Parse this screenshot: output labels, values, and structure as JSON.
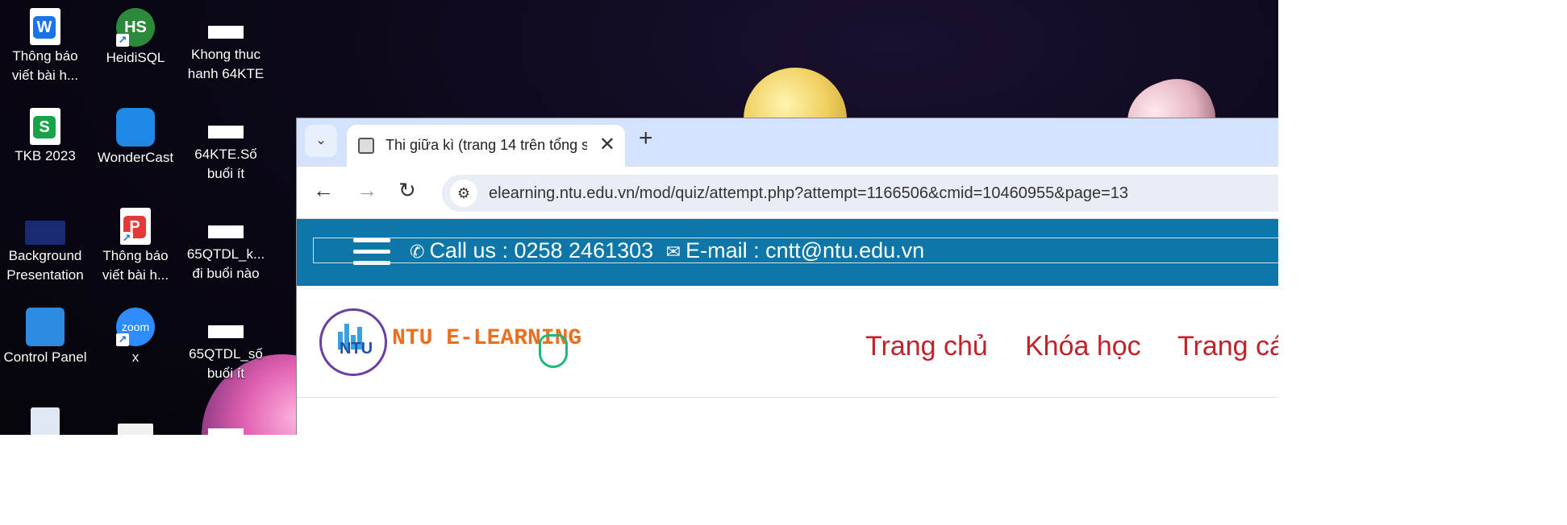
{
  "desktop": {
    "icons": [
      {
        "label_line1": "Thông báo",
        "label_line2": "viết bài h...",
        "icon": "word-doc-icon",
        "color": "#1a73e8"
      },
      {
        "label_line1": "HeidiSQL",
        "label_line2": "",
        "icon": "heidisql-icon",
        "color": "#2a8a3a"
      },
      {
        "label_line1": "Khong thuc",
        "label_line2": "hanh 64KTE",
        "icon": "blank-file-icon"
      },
      {
        "label_line1": "TKB 2023",
        "label_line2": "",
        "icon": "spreadsheet-doc-icon",
        "color": "#16a34a"
      },
      {
        "label_line1": "WonderCast",
        "label_line2": "",
        "icon": "wondercast-icon",
        "color": "#1e88e5"
      },
      {
        "label_line1": "64KTE.Số",
        "label_line2": "buổi ít",
        "icon": "blank-file-icon"
      },
      {
        "label_line1": "Background",
        "label_line2": "Presentation",
        "icon": "presentation-thumbnail-icon"
      },
      {
        "label_line1": "Thông báo",
        "label_line2": "viết bài h...",
        "icon": "pdf-doc-icon",
        "color": "#e53935"
      },
      {
        "label_line1": "65QTDL_k...",
        "label_line2": "đi buổi nào",
        "icon": "blank-file-icon"
      },
      {
        "label_line1": "Control Panel",
        "label_line2": "",
        "icon": "control-panel-icon"
      },
      {
        "label_line1": "x",
        "label_line2": "",
        "icon": "zoom-icon",
        "color": "#2d8cff",
        "text": "zoom"
      },
      {
        "label_line1": "65QTDL_số",
        "label_line2": "buổi ít",
        "icon": "blank-file-icon"
      }
    ]
  },
  "browser": {
    "tab": {
      "title": "Thi giữa kì (trang 14 trên tổng s",
      "close": "✕"
    },
    "new_tab": "+",
    "url": "elearning.ntu.edu.vn/mod/quiz/attempt.php?attempt=1166506&cmid=10460955&page=13"
  },
  "site": {
    "contact_phone": "Call us : 0258 2461303",
    "contact_email": "E-mail : cntt@ntu.edu.vn",
    "brand": "NTU E-LEARNING",
    "logo_text": "NTU",
    "menu": [
      "Trang chủ",
      "Khóa học",
      "Trang cá"
    ],
    "colors": {
      "topbar": "#0e77a8",
      "menu": "#c0222a",
      "brand": "#e87020"
    }
  }
}
